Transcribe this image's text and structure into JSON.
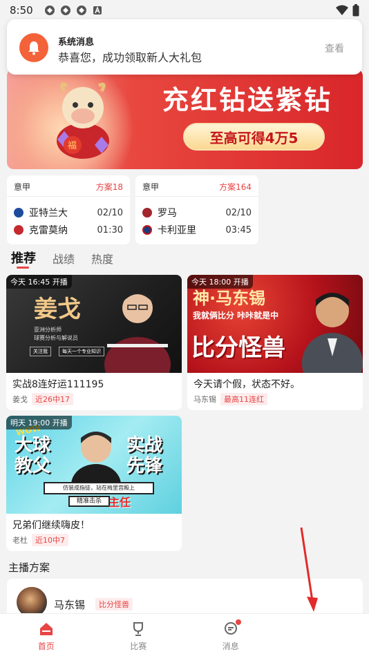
{
  "status_bar": {
    "time": "8:50"
  },
  "notification": {
    "title": "系统消息",
    "body": "恭喜您，成功领取新人大礼包",
    "action": "查看"
  },
  "banner": {
    "title": "充红钻送紫钻",
    "cta": "至高可得4万5",
    "mascot_text": "福"
  },
  "matches": [
    {
      "league": "意甲",
      "plan_count": "方案18",
      "home": {
        "name": "亚特兰大",
        "date": "02/10"
      },
      "away": {
        "name": "克雷莫纳",
        "time": "01:30"
      }
    },
    {
      "league": "意甲",
      "plan_count": "方案164",
      "home": {
        "name": "罗马",
        "date": "02/10"
      },
      "away": {
        "name": "卡利亚里",
        "time": "03:45"
      }
    }
  ],
  "tabs": [
    "推荐",
    "战绩",
    "热度"
  ],
  "videos": [
    {
      "badge": "今天 16:45 开播",
      "thumb_name": "姜戈",
      "thumb_sub1": "亚洲分析师",
      "thumb_sub2": "球赛分析与解说员",
      "thumb_btn1": "关注我",
      "thumb_btn2": "每天一个专业知识",
      "title": "实战8连好运111195",
      "author": "姜戈",
      "tag": "近26中17"
    },
    {
      "badge": "今天 18:00 开播",
      "thumb_name": "神·马东锡",
      "thumb_sub": "我就俩比分 咔咔就是中",
      "thumb_big": "比分怪兽",
      "title": "今天请个假，状态不好。",
      "author": "马东锡",
      "tag": "最高11连红"
    },
    {
      "badge": "明天 19:00 开播",
      "thumb_wow": "WOW",
      "thumb_left": "大球\n教父",
      "thumb_right": "实战\n先锋",
      "thumb_strip1": "仿装成指徒，站在梅里宫殿上",
      "thumb_strip2": "精准击杀",
      "thumb_stamp": "主任",
      "title": "兄弟们继续嗨皮！",
      "author": "老杜",
      "tag": "近10中7"
    }
  ],
  "section_title": "主播方案",
  "anchor": {
    "name": "马东锡",
    "tag": "比分怪兽"
  },
  "bottom_nav": [
    {
      "label": "首页",
      "icon": "home-icon",
      "active": true
    },
    {
      "label": "比赛",
      "icon": "trophy-icon",
      "active": false
    },
    {
      "label": "消息",
      "icon": "message-icon",
      "active": false
    },
    {
      "label": "",
      "icon": "",
      "active": false
    }
  ],
  "colors": {
    "accent": "#e84545",
    "background": "#f3f3f3"
  }
}
